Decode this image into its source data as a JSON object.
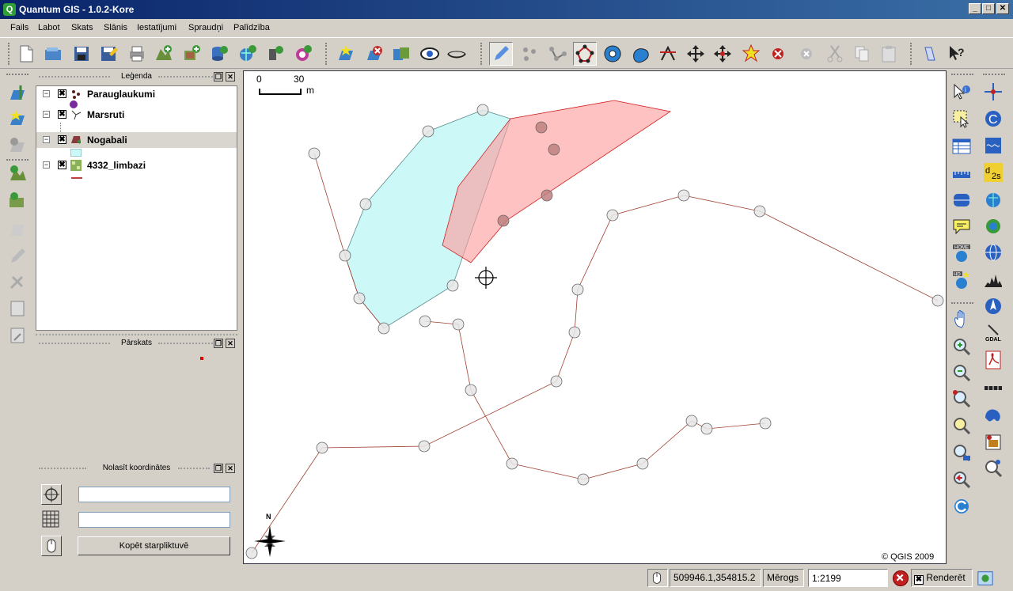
{
  "window": {
    "title": "Quantum GIS - 1.0.2-Kore",
    "app_icon": "Q"
  },
  "window_buttons": {
    "minimize": "_",
    "maximize": "□",
    "close": "✕"
  },
  "menu": [
    "Fails",
    "Labot",
    "Skats",
    "Slānis",
    "Iestatījumi",
    "Spraudņi",
    "Palīdzība"
  ],
  "panels": {
    "legend": {
      "title": "Leģenda",
      "layers": [
        {
          "name": "Parauglaukumi",
          "checked": "✖",
          "expanded": "⊟",
          "icon": "point-layer-icon"
        },
        {
          "name": "Marsruti",
          "checked": "✖",
          "expanded": "⊟",
          "icon": "line-layer-icon"
        },
        {
          "name": "Nogabali",
          "checked": "✖",
          "expanded": "⊟",
          "icon": "polygon-layer-icon",
          "selected": true
        },
        {
          "name": "4332_limbazi",
          "checked": "✖",
          "expanded": "⊟",
          "icon": "raster-layer-icon"
        }
      ]
    },
    "overview": {
      "title": "Pārskats"
    },
    "coordinates": {
      "title": "Nolasīt koordinātes",
      "field1": "",
      "field2": "",
      "copy_button": "Kopēt starpliktuvē"
    }
  },
  "map": {
    "scalebar": {
      "start": "0",
      "end": "30",
      "unit": "m"
    },
    "copyright": "© QGIS 2009",
    "north_label": "N",
    "colors": {
      "polygon_cyan": "#ccf8f8",
      "polygon_red": "#ff9999",
      "line": "#a04030",
      "vertex": "#e6e6e6"
    }
  },
  "status": {
    "coordinates": "509946.1,354815.2",
    "scale_label": "Mērogs",
    "scale_value": "1:2199",
    "render_label": "Renderēt",
    "render_checked": "✖"
  }
}
